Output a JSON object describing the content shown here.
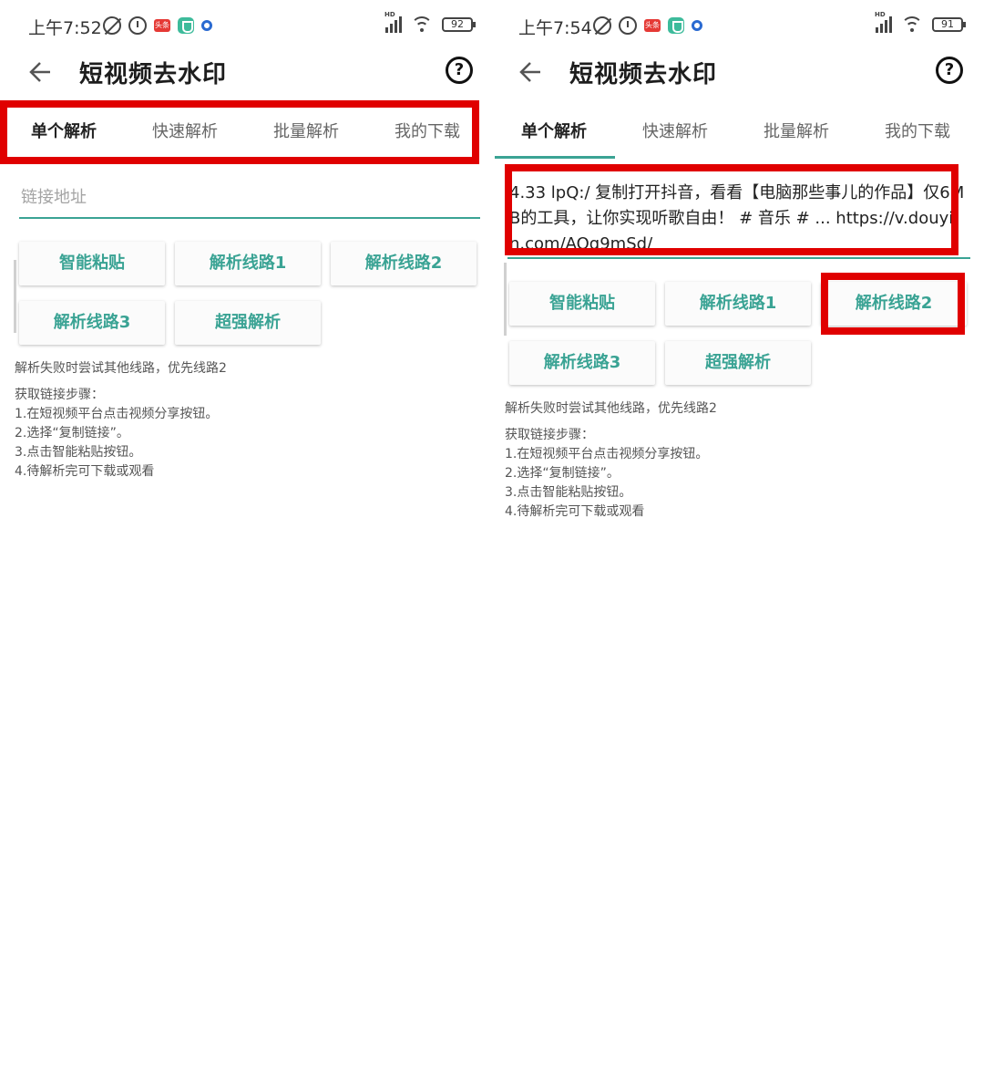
{
  "left": {
    "status": {
      "time": "上午7:52",
      "battery": "92",
      "news_label": "头条"
    },
    "app_title": "短视频去水印",
    "help": "?",
    "tabs": [
      "单个解析",
      "快速解析",
      "批量解析",
      "我的下载"
    ],
    "input": {
      "placeholder": "链接地址",
      "value": ""
    },
    "buttons": [
      "智能粘贴",
      "解析线路1",
      "解析线路2",
      "解析线路3",
      "超强解析"
    ],
    "hint": "解析失败时尝试其他线路，优先线路2",
    "steps_title": "获取链接步骤：",
    "steps": [
      "1.在短视频平台点击视频分享按钮。",
      "2.选择“复制链接”。",
      "3.点击智能粘贴按钮。",
      "4.待解析完可下载或观看"
    ]
  },
  "right": {
    "status": {
      "time": "上午7:54",
      "battery": "91",
      "news_label": "头条"
    },
    "app_title": "短视频去水印",
    "help": "?",
    "tabs": [
      "单个解析",
      "快速解析",
      "批量解析",
      "我的下载"
    ],
    "input": {
      "placeholder": "链接地址",
      "value": "4.33 lpQ:/ 复制打开抖音，看看【电脑那些事儿的作品】仅6MB的工具，让你实现听歌自由！ # 音乐 # ... https://v.douyin.com/AQq9mSd/"
    },
    "buttons": [
      "智能粘贴",
      "解析线路1",
      "解析线路2",
      "解析线路3",
      "超强解析"
    ],
    "hint": "解析失败时尝试其他线路，优先线路2",
    "steps_title": "获取链接步骤：",
    "steps": [
      "1.在短视频平台点击视频分享按钮。",
      "2.选择“复制链接”。",
      "3.点击智能粘贴按钮。",
      "4.待解析完可下载或观看"
    ]
  },
  "icons": {
    "back": "back-arrow-icon",
    "help": "help-circle-icon",
    "mute": "mute-icon",
    "alarm": "alarm-icon",
    "news": "news-app-icon",
    "shield": "shield-icon",
    "dot": "circle-dot-icon",
    "signal": "signal-icon",
    "wifi": "wifi-icon",
    "battery": "battery-icon"
  },
  "colors": {
    "accent": "#3aa394",
    "highlight": "#e00000",
    "background": "#ffffff"
  }
}
